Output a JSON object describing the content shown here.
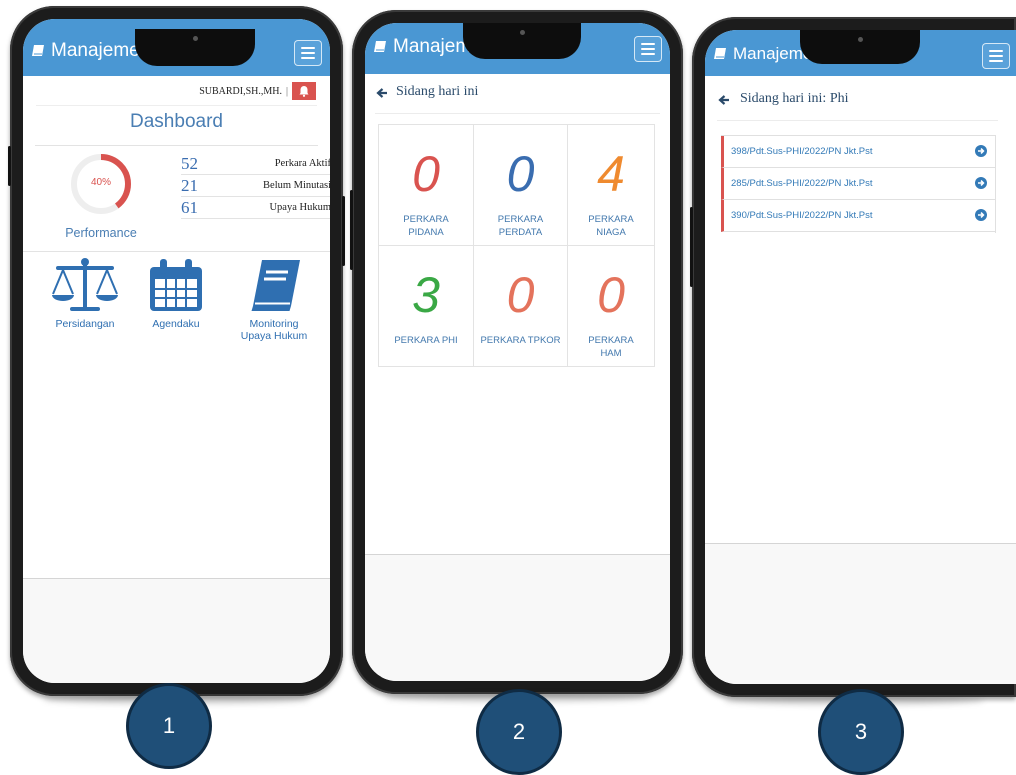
{
  "app": {
    "title": "Manajemen"
  },
  "phone1": {
    "user_name": "SUBARDI,SH.,MH.",
    "separator": "|",
    "heading": "Dashboard",
    "gauge": {
      "percent": 40,
      "label": "40%",
      "caption": "Performance"
    },
    "stats": [
      {
        "value": "52",
        "label": "Perkara Aktif"
      },
      {
        "value": "21",
        "label": "Belum Minutasi"
      },
      {
        "value": "61",
        "label": "Upaya Hukum"
      }
    ],
    "menu": [
      {
        "label": "Persidangan",
        "icon": "scales-icon"
      },
      {
        "label": "Agendaku",
        "icon": "calendar-icon"
      },
      {
        "label_line1": "Monitoring",
        "label_line2": "Upaya Hukum",
        "icon": "book-icon"
      }
    ],
    "colors": {
      "gauge": "#d9534f",
      "bell": "#d9534f"
    }
  },
  "phone2": {
    "heading": "Sidang hari ini",
    "cells": [
      {
        "value": "0",
        "line1": "PERKARA",
        "line2": "PIDANA",
        "color": "#d9534f"
      },
      {
        "value": "0",
        "line1": "PERKARA",
        "line2": "PERDATA",
        "color": "#3a6db0"
      },
      {
        "value": "4",
        "line1": "PERKARA",
        "line2": "NIAGA",
        "color": "#ef8a2f"
      },
      {
        "value": "3",
        "line1": "PERKARA PHI",
        "line2": "",
        "color": "#3aa845"
      },
      {
        "value": "0",
        "line1": "PERKARA TPKOR",
        "line2": "",
        "color": "#e4735c"
      },
      {
        "value": "0",
        "line1": "PERKARA",
        "line2": "HAM",
        "color": "#e4735c"
      }
    ]
  },
  "phone3": {
    "heading": "Sidang hari ini: Phi",
    "cases": [
      "398/Pdt.Sus-PHI/2022/PN Jkt.Pst",
      "285/Pdt.Sus-PHI/2022/PN Jkt.Pst",
      "390/Pdt.Sus-PHI/2022/PN Jkt.Pst"
    ]
  },
  "markers": [
    "1",
    "2",
    "3"
  ],
  "colors": {
    "appbar": "#4a97d3",
    "marker": "#1f4f78"
  }
}
